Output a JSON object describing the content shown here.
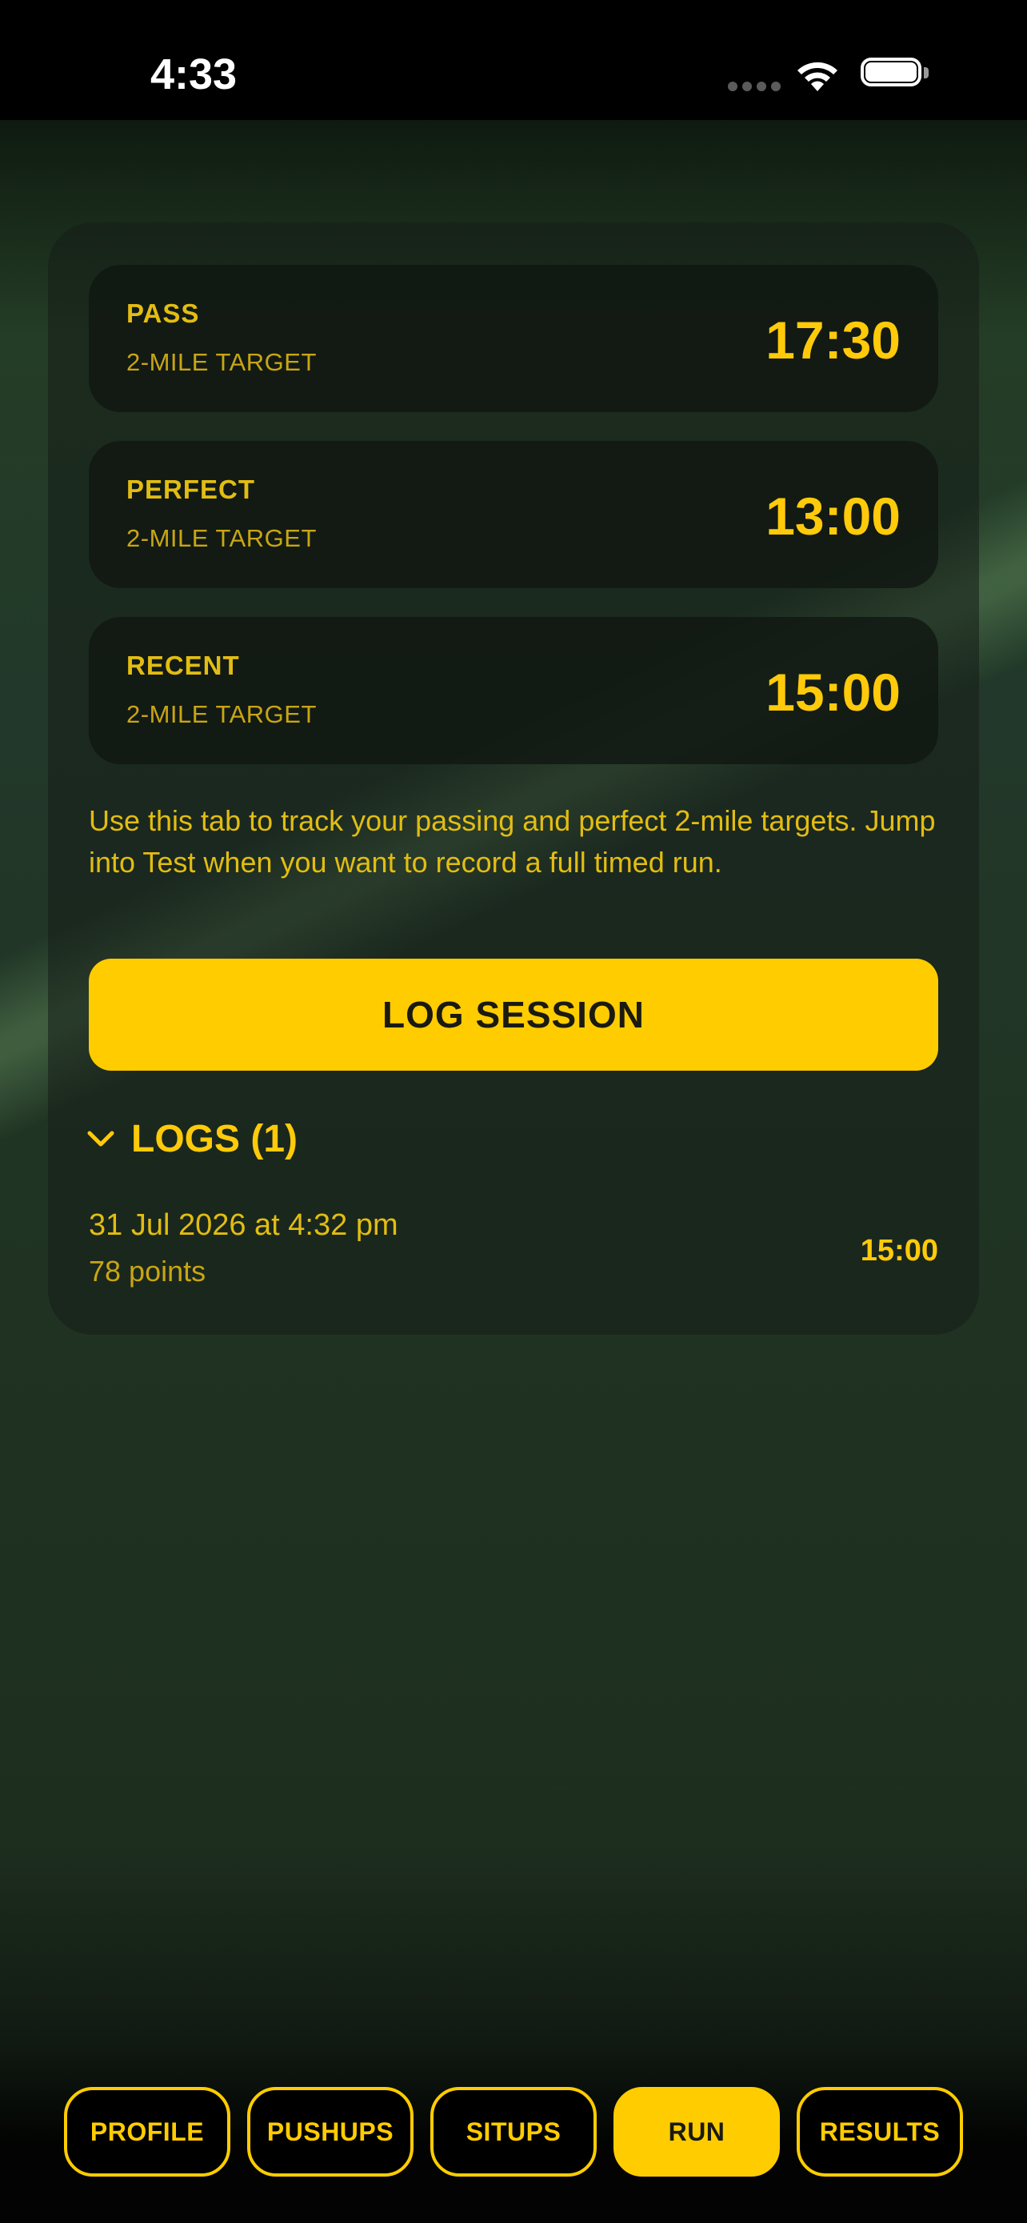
{
  "status_bar": {
    "time": "4:33"
  },
  "targets": [
    {
      "label": "PASS",
      "sub": "2-MILE TARGET",
      "value": "17:30"
    },
    {
      "label": "PERFECT",
      "sub": "2-MILE TARGET",
      "value": "13:00"
    },
    {
      "label": "RECENT",
      "sub": "2-MILE TARGET",
      "value": "15:00"
    }
  ],
  "description": "Use this tab to track your passing and perfect 2-mile targets. Jump into Test when you want to record a full timed run.",
  "log_button": "LOG SESSION",
  "logs": {
    "title": "LOGS (1)",
    "entries": [
      {
        "date": "31 Jul 2026 at 4:32 pm",
        "points": "78 points",
        "value": "15:00"
      }
    ]
  },
  "tabs": [
    {
      "label": "PROFILE",
      "active": false
    },
    {
      "label": "PUSHUPS",
      "active": false
    },
    {
      "label": "SITUPS",
      "active": false
    },
    {
      "label": "RUN",
      "active": true
    },
    {
      "label": "RESULTS",
      "active": false
    }
  ],
  "colors": {
    "accent": "#ffcc00",
    "text_gold": "#e2bd12"
  }
}
